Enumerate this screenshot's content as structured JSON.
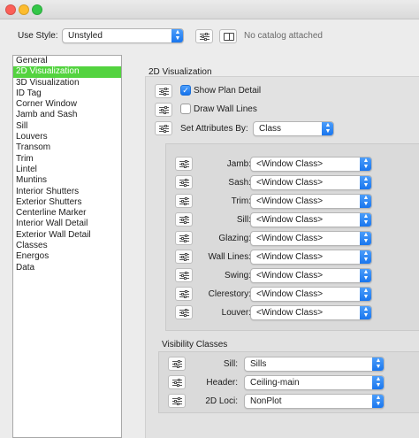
{
  "toolbar": {
    "use_style_label": "Use Style:",
    "style_value": "Unstyled",
    "catalog_text": "No catalog attached"
  },
  "sidebar": {
    "items": [
      "General",
      "2D Visualization",
      "3D Visualization",
      "ID Tag",
      "Corner Window",
      "Jamb and Sash",
      "Sill",
      "Louvers",
      "Transom",
      "Trim",
      "Lintel",
      "Muntins",
      "Interior Shutters",
      "Exterior Shutters",
      "Centerline Marker",
      "Interior Wall Detail",
      "Exterior Wall Detail",
      "Classes",
      "Energos",
      "Data"
    ],
    "selected_index": 1
  },
  "main": {
    "section_title": "2D Visualization",
    "show_plan_detail": {
      "label": "Show Plan Detail",
      "checked": true
    },
    "draw_wall_lines": {
      "label": "Draw Wall Lines",
      "checked": false
    },
    "set_attributes": {
      "label": "Set Attributes By:",
      "value": "Class"
    },
    "class_rows": [
      {
        "label": "Jamb:",
        "value": "<Window Class>"
      },
      {
        "label": "Sash:",
        "value": "<Window Class>"
      },
      {
        "label": "Trim:",
        "value": "<Window Class>"
      },
      {
        "label": "Sill:",
        "value": "<Window Class>"
      },
      {
        "label": "Glazing:",
        "value": "<Window Class>"
      },
      {
        "label": "Wall Lines:",
        "value": "<Window Class>"
      },
      {
        "label": "Swing:",
        "value": "<Window Class>"
      },
      {
        "label": "Clerestory:",
        "value": "<Window Class>"
      },
      {
        "label": "Louver:",
        "value": "<Window Class>"
      }
    ],
    "visibility_title": "Visibility Classes",
    "visibility_rows": [
      {
        "label": "Sill:",
        "value": "Sills"
      },
      {
        "label": "Header:",
        "value": "Ceiling-main"
      },
      {
        "label": "2D Loci:",
        "value": "NonPlot"
      }
    ]
  },
  "colors": {
    "selection": "#53d33f",
    "popup_accent": "#1673ed"
  }
}
